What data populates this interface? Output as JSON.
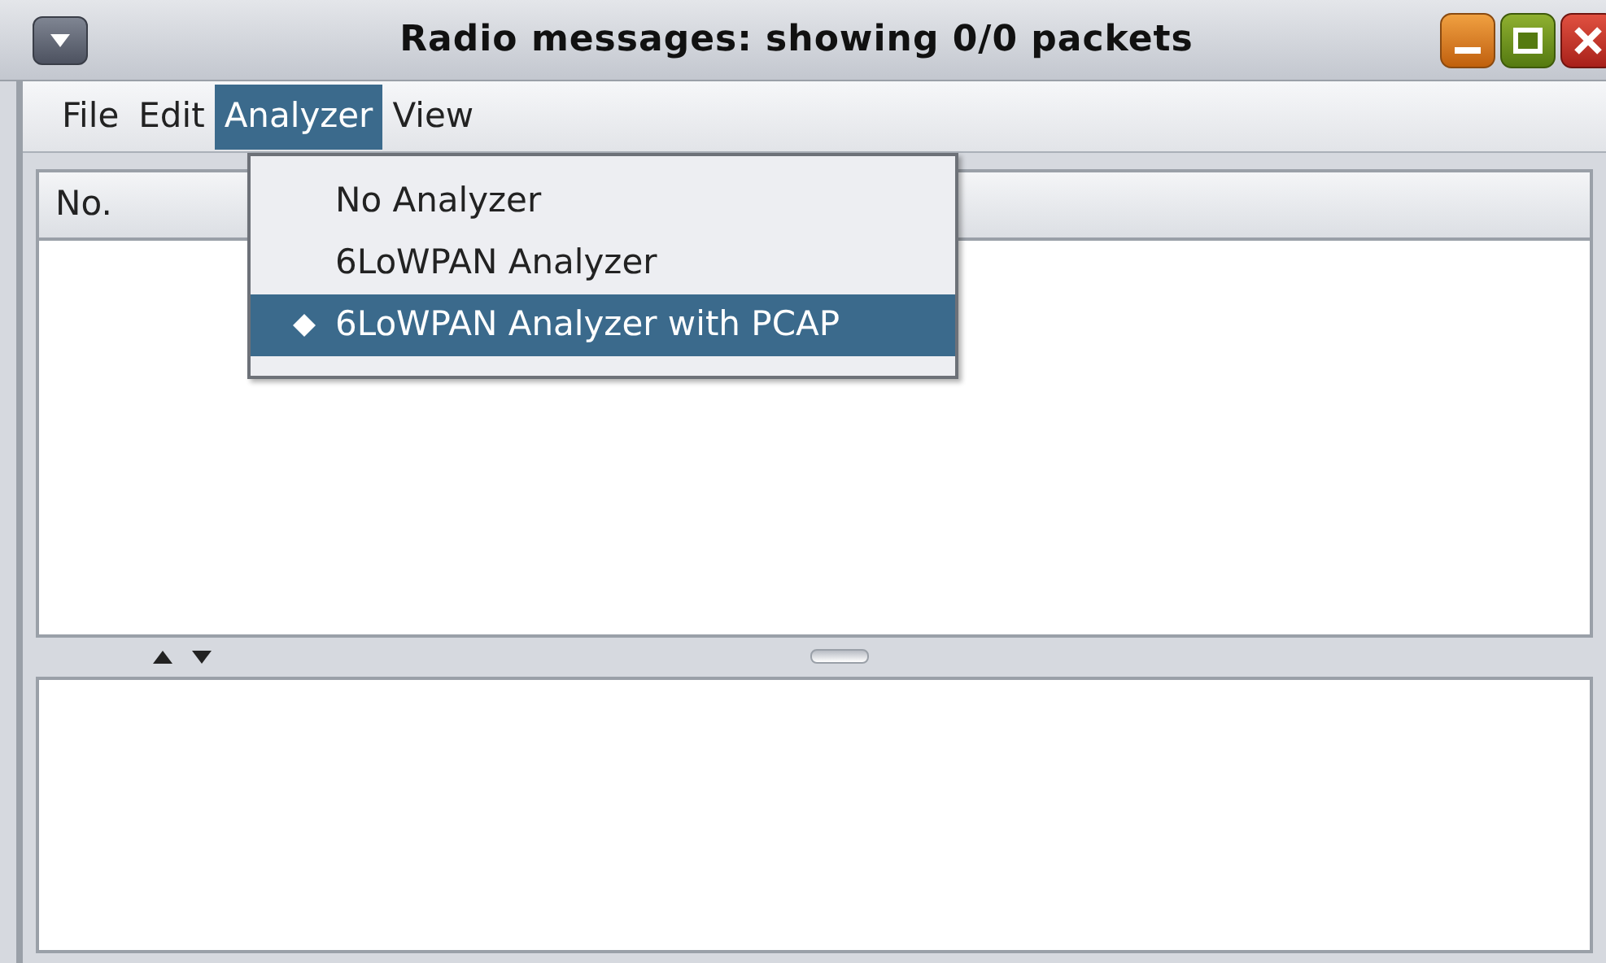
{
  "window": {
    "title": "Radio messages: showing 0/0 packets"
  },
  "menu_bar": [
    {
      "label": "File",
      "selected": false
    },
    {
      "label": "Edit",
      "selected": false
    },
    {
      "label": "Analyzer",
      "selected": true
    },
    {
      "label": "View",
      "selected": false
    }
  ],
  "analyzer_menu": [
    {
      "label": "No Analyzer",
      "checked": false,
      "selected": false
    },
    {
      "label": "6LoWPAN Analyzer",
      "checked": false,
      "selected": false
    },
    {
      "label": "6LoWPAN Analyzer with PCAP",
      "checked": true,
      "selected": true
    }
  ],
  "table": {
    "columns": [
      "No."
    ]
  }
}
